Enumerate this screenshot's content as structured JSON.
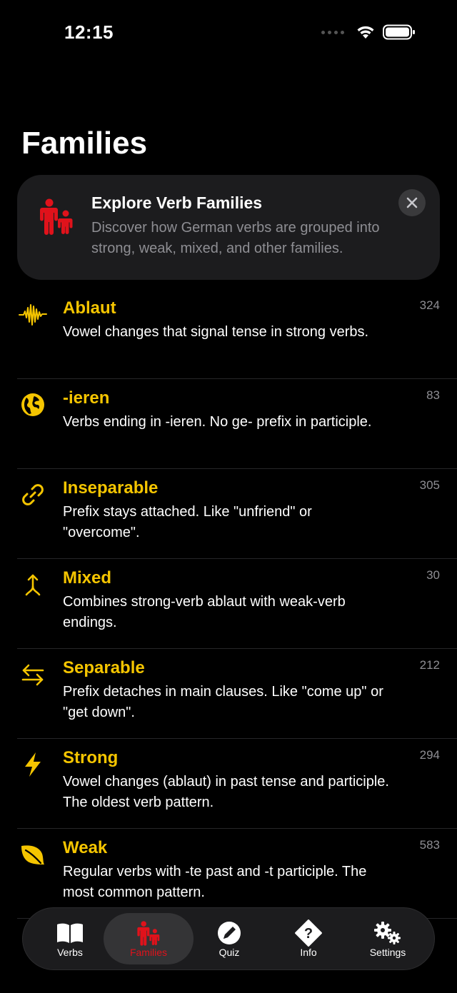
{
  "status": {
    "time": "12:15"
  },
  "page": {
    "title": "Families"
  },
  "banner": {
    "title": "Explore Verb Families",
    "text": "Discover how German verbs are grouped into strong, weak, mixed, and other families.",
    "icon": "family-icon"
  },
  "families": [
    {
      "name": "Ablaut",
      "description": "Vowel changes that signal tense in strong verbs.",
      "count": "324",
      "icon": "waveform-icon"
    },
    {
      "name": "-ieren",
      "description": "Verbs ending in -ieren. No ge- prefix in participle.",
      "count": "83",
      "icon": "globe-icon"
    },
    {
      "name": "Inseparable",
      "description": "Prefix stays attached. Like \"unfriend\" or \"overcome\".",
      "count": "305",
      "icon": "link-icon"
    },
    {
      "name": "Mixed",
      "description": "Combines strong-verb ablaut with weak-verb endings.",
      "count": "30",
      "icon": "merge-arrow-icon"
    },
    {
      "name": "Separable",
      "description": "Prefix detaches in main clauses. Like \"come up\" or \"get down\".",
      "count": "212",
      "icon": "swap-arrows-icon"
    },
    {
      "name": "Strong",
      "description": "Vowel changes (ablaut) in past tense and participle. The oldest verb pattern.",
      "count": "294",
      "icon": "bolt-icon"
    },
    {
      "name": "Weak",
      "description": "Regular verbs with -te past and -t participle. The most common pattern.",
      "count": "583",
      "icon": "leaf-icon"
    }
  ],
  "tabs": [
    {
      "label": "Verbs",
      "icon": "book-icon"
    },
    {
      "label": "Families",
      "icon": "family-icon",
      "active": true
    },
    {
      "label": "Quiz",
      "icon": "pencil-icon"
    },
    {
      "label": "Info",
      "icon": "question-icon"
    },
    {
      "label": "Settings",
      "icon": "gears-icon"
    }
  ],
  "colors": {
    "accent": "#F5C500",
    "active_tab": "#E0121B",
    "background": "#000000",
    "card": "#1C1C1E",
    "secondary_text": "#8E8E93"
  }
}
